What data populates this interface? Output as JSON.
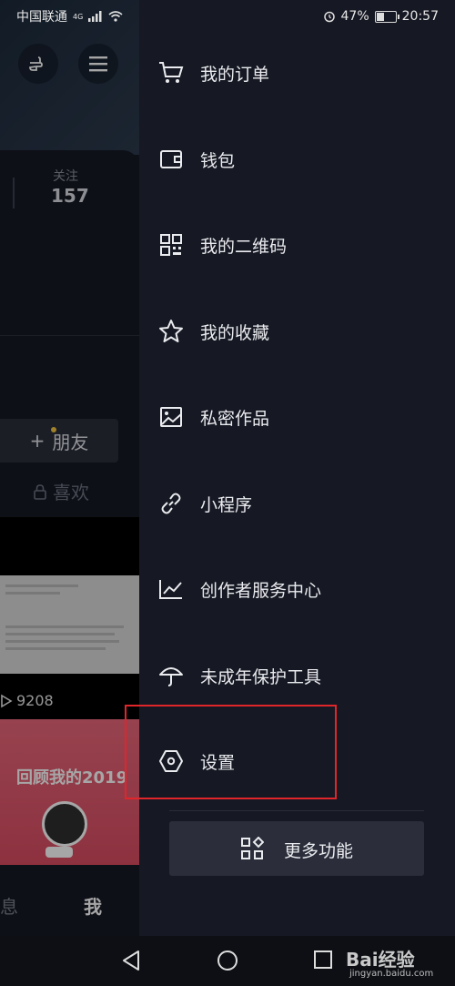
{
  "status_bar": {
    "carrier": "中国联通",
    "network": "4G",
    "battery": "47%",
    "battery_level": 0.47,
    "time": "20:57"
  },
  "background": {
    "stat_label": "关注",
    "stat_value": "157",
    "friends_tab": "朋友",
    "likes_tab": "喜欢",
    "play_count": "9208",
    "video_title": "回顾我的2019",
    "nav_messages": "息",
    "nav_me": "我"
  },
  "drawer": {
    "menu": [
      {
        "label": "我的订单",
        "icon": "cart-icon"
      },
      {
        "label": "钱包",
        "icon": "wallet-icon"
      },
      {
        "label": "我的二维码",
        "icon": "qr-code-icon"
      },
      {
        "label": "我的收藏",
        "icon": "star-icon"
      },
      {
        "label": "私密作品",
        "icon": "image-icon"
      },
      {
        "label": "小程序",
        "icon": "link-icon"
      },
      {
        "label": "创作者服务中心",
        "icon": "chart-icon"
      },
      {
        "label": "未成年保护工具",
        "icon": "umbrella-icon"
      },
      {
        "label": "设置",
        "icon": "settings-icon"
      }
    ],
    "more_button": "更多功能"
  },
  "watermark": {
    "brand": "Bai经验",
    "url": "jingyan.baidu.com"
  },
  "colors": {
    "drawer_bg": "#161823",
    "highlight": "#e0262b",
    "notification_dot": "#f7c843"
  }
}
